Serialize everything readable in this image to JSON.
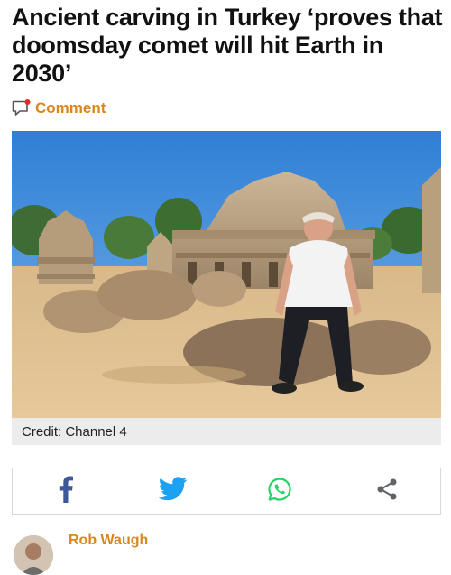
{
  "article": {
    "headline": "Ancient carving in Turkey ‘proves that doomsday comet will hit Earth in 2030’",
    "comment_label": "Comment",
    "image_caption": "Credit: Channel 4",
    "author": "Rob Waugh"
  },
  "share": {
    "buttons": [
      {
        "name": "facebook",
        "icon": "facebook-icon",
        "color": "#3b5998"
      },
      {
        "name": "twitter",
        "icon": "twitter-icon",
        "color": "#1da1f2"
      },
      {
        "name": "whatsapp",
        "icon": "whatsapp-icon",
        "color": "#25d366"
      },
      {
        "name": "share",
        "icon": "share-icon",
        "color": "#5f6368"
      }
    ]
  },
  "colors": {
    "accent": "#d8871c",
    "headline": "#111111",
    "caption_bg": "#ececec"
  }
}
